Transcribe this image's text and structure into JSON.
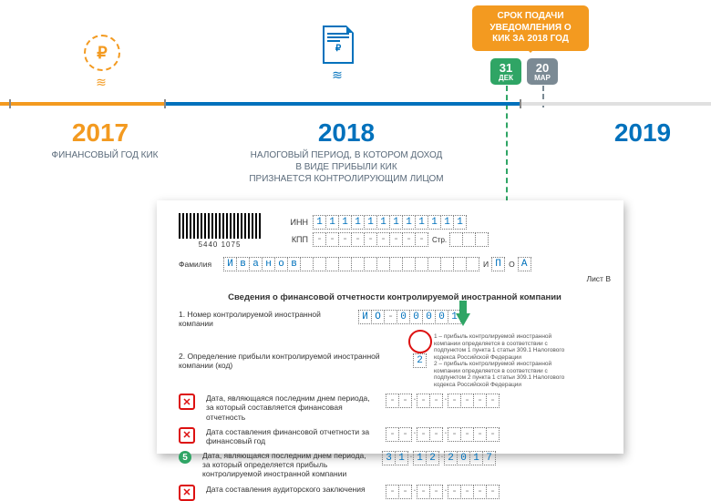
{
  "callout": {
    "line1": "СРОК ПОДАЧИ",
    "line2": "УВЕДОМЛЕНИЯ О",
    "line3": "КИК ЗА 2018 ГОД"
  },
  "badges": {
    "dec": {
      "day": "31",
      "month": "ДЕК"
    },
    "mar": {
      "day": "20",
      "month": "МАР"
    }
  },
  "years": {
    "y2017": "2017",
    "y2018": "2018",
    "y2019": "2019",
    "sub2017": "ФИНАНСОВЫЙ ГОД КИК",
    "sub2018_l1": "НАЛОГОВЫЙ ПЕРИОД, В КОТОРОМ ДОХОД",
    "sub2018_l2": "В ВИДЕ ПРИБЫЛИ КИК",
    "sub2018_l3": "ПРИЗНАЕТСЯ КОНТРОЛИРУЮЩИМ ЛИЦОМ"
  },
  "form": {
    "barcode": "5440 1075",
    "inn_label": "ИНН",
    "inn": [
      "1",
      "1",
      "1",
      "1",
      "1",
      "1",
      "1",
      "1",
      "1",
      "1",
      "1",
      "1"
    ],
    "kpp_label": "КПП",
    "kpp": [
      "-",
      "-",
      "-",
      "-",
      "-",
      "-",
      "-",
      "-",
      "-"
    ],
    "str_label": "Стр.",
    "surname_label": "Фамилия",
    "surname": "Иванов",
    "i_label": "И",
    "i_val": "П",
    "o_label": "О",
    "o_val": "А",
    "list_v": "Лист В",
    "section_title": "Сведения о финансовой отчетности контролируемой иностранной компании",
    "q1_label": "1. Номер контролируемой иностранной компании",
    "q1_cells": [
      "И",
      "О",
      "-",
      "0",
      "0",
      "0",
      "0",
      "1"
    ],
    "q2_label": "2. Определение прибыли контролируемой иностранной компании (код)",
    "q2_val": "2",
    "q2_note": "1 – прибыль контролируемой иностранной компании определяется в соответствии с подпунктом 1 пункта 1 статьи 309.1 Налогового кодекса Российской Федерации\n2 – прибыль контролируемой иностранной компании определяется в соответствии с подпунктом 2 пункта 1 статьи 309.1 Налогового кодекса Российской Федерации",
    "x1": "Дата, являющаяся последним днем периода, за который составляется финансовая отчетность",
    "x2": "Дата составления финансовой отчетности за финансовый год",
    "ok": "Дата, являющаяся последним днем периода, за который определяется прибыль контролируемой иностранной компании",
    "ok_date": {
      "d": [
        "3",
        "1"
      ],
      "m": [
        "1",
        "2"
      ],
      "y": [
        "2",
        "0",
        "1",
        "7"
      ]
    },
    "x3": "Дата составления аудиторского заключения"
  }
}
